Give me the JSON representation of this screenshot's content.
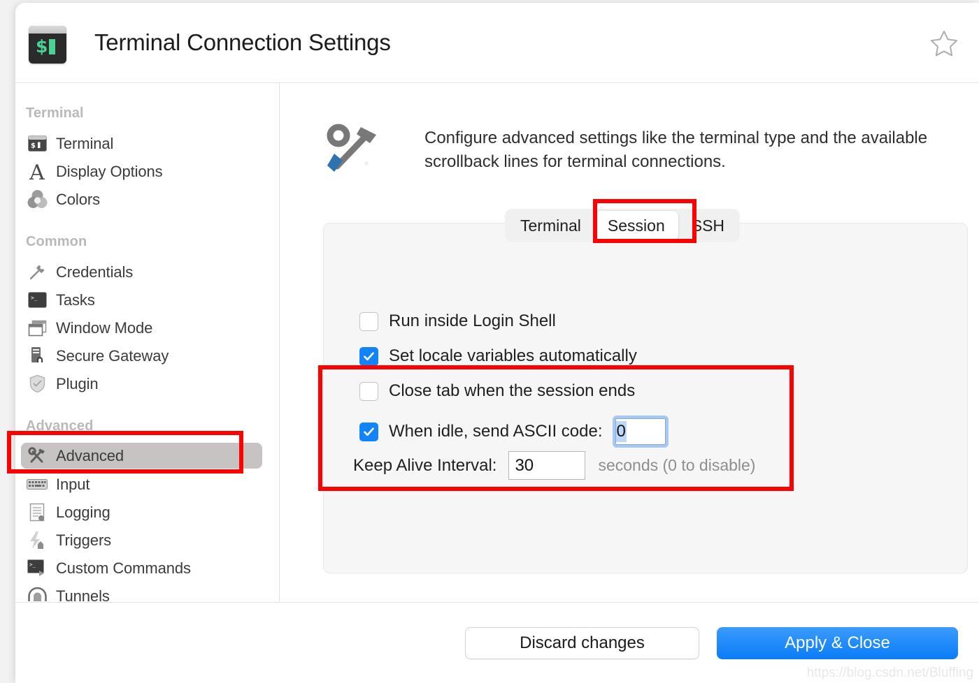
{
  "window": {
    "title": "Terminal Connection Settings",
    "app_icon": "terminal-prompt-icon",
    "favorite_icon": "star-outline-icon"
  },
  "sidebar": {
    "groups": [
      {
        "title": "Terminal",
        "items": [
          {
            "label": "Terminal",
            "icon": "terminal-icon",
            "selected": false
          },
          {
            "label": "Display Options",
            "icon": "font-letter-a-icon",
            "selected": false
          },
          {
            "label": "Colors",
            "icon": "color-circles-icon",
            "selected": false
          }
        ]
      },
      {
        "title": "Common",
        "items": [
          {
            "label": "Credentials",
            "icon": "key-icon",
            "selected": false
          },
          {
            "label": "Tasks",
            "icon": "terminal-tasks-icon",
            "selected": false
          },
          {
            "label": "Window Mode",
            "icon": "windows-stack-icon",
            "selected": false
          },
          {
            "label": "Secure Gateway",
            "icon": "server-lock-icon",
            "selected": false
          },
          {
            "label": "Plugin",
            "icon": "plugin-shield-icon",
            "selected": false
          }
        ]
      },
      {
        "title": "Advanced",
        "items": [
          {
            "label": "Advanced",
            "icon": "wrench-hammer-icon",
            "selected": true
          },
          {
            "label": "Input",
            "icon": "keyboard-icon",
            "selected": false
          },
          {
            "label": "Logging",
            "icon": "log-document-icon",
            "selected": false
          },
          {
            "label": "Triggers",
            "icon": "lightning-bolt-icon",
            "selected": false
          },
          {
            "label": "Custom Commands",
            "icon": "terminal-play-icon",
            "selected": false
          },
          {
            "label": "Tunnels",
            "icon": "tunnel-arch-icon",
            "selected": false
          }
        ]
      }
    ]
  },
  "main": {
    "description": "Configure advanced settings like the terminal type and the available scrollback lines for terminal connections.",
    "description_icon": "wrench-hammer-icon",
    "tabs": [
      {
        "label": "Terminal",
        "active": false
      },
      {
        "label": "Session",
        "active": true
      },
      {
        "label": "SSH",
        "active": false
      }
    ],
    "settings": {
      "run_login_shell": {
        "label": "Run inside Login Shell",
        "checked": false
      },
      "set_locale": {
        "label": "Set locale variables automatically",
        "checked": true
      },
      "close_tab": {
        "label": "Close tab when the session ends",
        "checked": false
      },
      "idle_ascii": {
        "label": "When idle, send ASCII code:",
        "checked": true,
        "value": "0",
        "focused": true
      },
      "keep_alive": {
        "label": "Keep Alive Interval:",
        "value": "30",
        "hint": "seconds (0 to disable)"
      }
    }
  },
  "footer": {
    "discard_label": "Discard changes",
    "apply_label": "Apply & Close"
  },
  "watermark": "https://blog.csdn.net/Bluffing",
  "colors": {
    "accent_blue": "#1184fc",
    "annotation_red": "#fe0000",
    "selected_row": "#c8c3c3",
    "terminal_green": "#4ad295"
  }
}
